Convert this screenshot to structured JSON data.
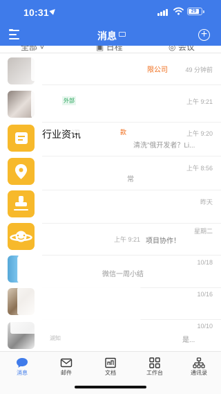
{
  "status_bar": {
    "time": "10:31",
    "location_icon": "location-arrow-icon",
    "battery": "29"
  },
  "nav": {
    "title": "消息",
    "menu_icon": "hamburger-icon",
    "add_icon": "plus-circle-icon"
  },
  "filter": {
    "tabs": [
      "全部",
      "日程",
      "会议"
    ]
  },
  "messages": [
    {
      "name": "",
      "preview": "",
      "extra": "限公司",
      "time": "49 分钟前"
    },
    {
      "name": "",
      "tag": "外部",
      "preview": "",
      "time": "上午 9:21"
    },
    {
      "name": "行业资讯",
      "preview": "清洗”俄开发者？Li...",
      "extra": "款",
      "time": "上午 9:20"
    },
    {
      "name": "",
      "preview": "常",
      "time": "上午 8:56"
    },
    {
      "name": "",
      "preview": "",
      "time": "昨天"
    },
    {
      "name": "",
      "preview": "上午 9:21",
      "extra": "项目协作！",
      "time": "星期二"
    },
    {
      "name": "",
      "preview": "微信一周小结",
      "time": "10/18"
    },
    {
      "name": "",
      "preview": "",
      "time": "10/16"
    },
    {
      "name": "",
      "preview": "是...",
      "extra": "湖知",
      "time": "10/10"
    }
  ],
  "tabbar": [
    {
      "label": "消息",
      "icon": "chat-bubble-icon"
    },
    {
      "label": "邮件",
      "icon": "mail-icon"
    },
    {
      "label": "文档",
      "icon": "document-icon"
    },
    {
      "label": "工作台",
      "icon": "grid-icon"
    },
    {
      "label": "通讯录",
      "icon": "contacts-icon"
    }
  ],
  "colors": {
    "primary": "#3f7bea",
    "app_yellow": "#f7b92b",
    "external_tag": "#27a55a",
    "highlight_orange": "#f06d1b",
    "active_tab": "#3f7bea"
  }
}
